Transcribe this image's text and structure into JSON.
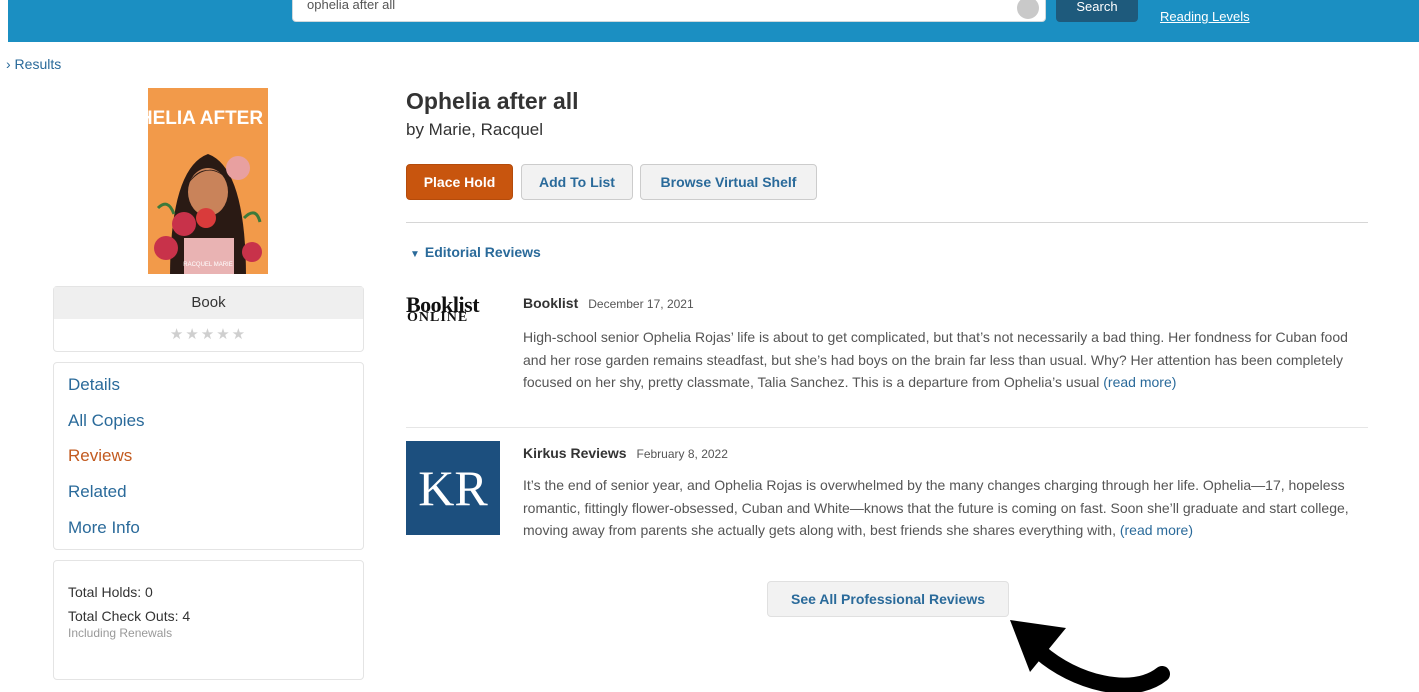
{
  "header": {
    "search_value": "ophelia after all",
    "search_button_label": "Search",
    "reading_levels_link": "Reading Levels"
  },
  "breadcrumb": {
    "back_label": "› Results"
  },
  "book": {
    "cover_title": "OPHELIA AFTER ALL",
    "cover_author": "RACQUEL MARIE",
    "format": "Book",
    "rating_stars": "★★★★★",
    "rating_value": 0,
    "title": "Ophelia after all",
    "author": "by Marie, Racquel"
  },
  "sidebar": {
    "items": [
      {
        "label": "Details",
        "active": false
      },
      {
        "label": "All Copies",
        "active": false
      },
      {
        "label": "Reviews",
        "active": true
      },
      {
        "label": "Related",
        "active": false
      },
      {
        "label": "More Info",
        "active": false
      }
    ]
  },
  "stats": {
    "total_holds": "Total Holds: 0",
    "total_checkouts": "Total Check Outs: 4",
    "including": "Including Renewals"
  },
  "actions": {
    "place_hold": "Place Hold",
    "add_to_list": "Add To List",
    "browse_shelf": "Browse Virtual Shelf"
  },
  "reviews_section": {
    "heading": "Editorial Reviews",
    "reviews": [
      {
        "logo_line1": "Booklist",
        "logo_line2": "ONLINE",
        "source": "Booklist",
        "date": "December 17, 2021",
        "text": "High-school senior Ophelia Rojas’ life is about to get complicated, but that’s not necessarily a bad thing. Her fondness for Cuban food and her rose garden remains steadfast, but she’s had boys on the brain far less than usual. Why? Her attention has been completely focused on her shy, pretty classmate, Talia Sanchez. This is a departure from Ophelia’s usual",
        "read_more": "(read more)"
      },
      {
        "logo_text": "KR",
        "source": "Kirkus Reviews",
        "date": "February 8, 2022",
        "text": "It’s the end of senior year, and Ophelia Rojas is overwhelmed by the many changes charging through her life. Ophelia—17, hopeless romantic, fittingly flower-obsessed, Cuban and White—knows that the future is coming on fast. Soon she’ll graduate and start college, moving away from parents she actually gets along with, best friends she shares everything with,",
        "read_more": "(read more)"
      }
    ],
    "see_all": "See All Professional Reviews"
  },
  "colors": {
    "header_bg": "#1b8fc2",
    "link": "#2a6a9a",
    "place_hold": "#c8550e",
    "active_nav": "#c25a1f",
    "kirkus_blue": "#1c4f7e"
  }
}
